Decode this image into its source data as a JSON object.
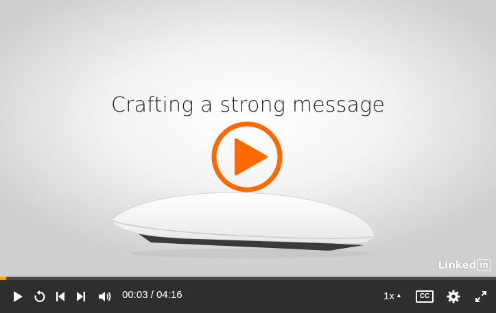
{
  "video": {
    "slide_title": "Crafting a strong message",
    "watermark_text": "Linked",
    "watermark_box_text": "in",
    "progress_fraction": 0.012
  },
  "controls": {
    "current_time": "00:03",
    "separator": " / ",
    "duration": "04:16",
    "speed_label": "1x",
    "cc_label": "CC"
  },
  "colors": {
    "accent_progress": "#f5a400",
    "play_overlay": "#ff6a00",
    "control_bar": "#2e2e2e"
  },
  "icons": [
    "play-icon",
    "replay-icon",
    "previous-icon",
    "next-icon",
    "volume-icon",
    "speed-caret-icon",
    "cc-icon",
    "settings-gear-icon",
    "fullscreen-icon"
  ]
}
